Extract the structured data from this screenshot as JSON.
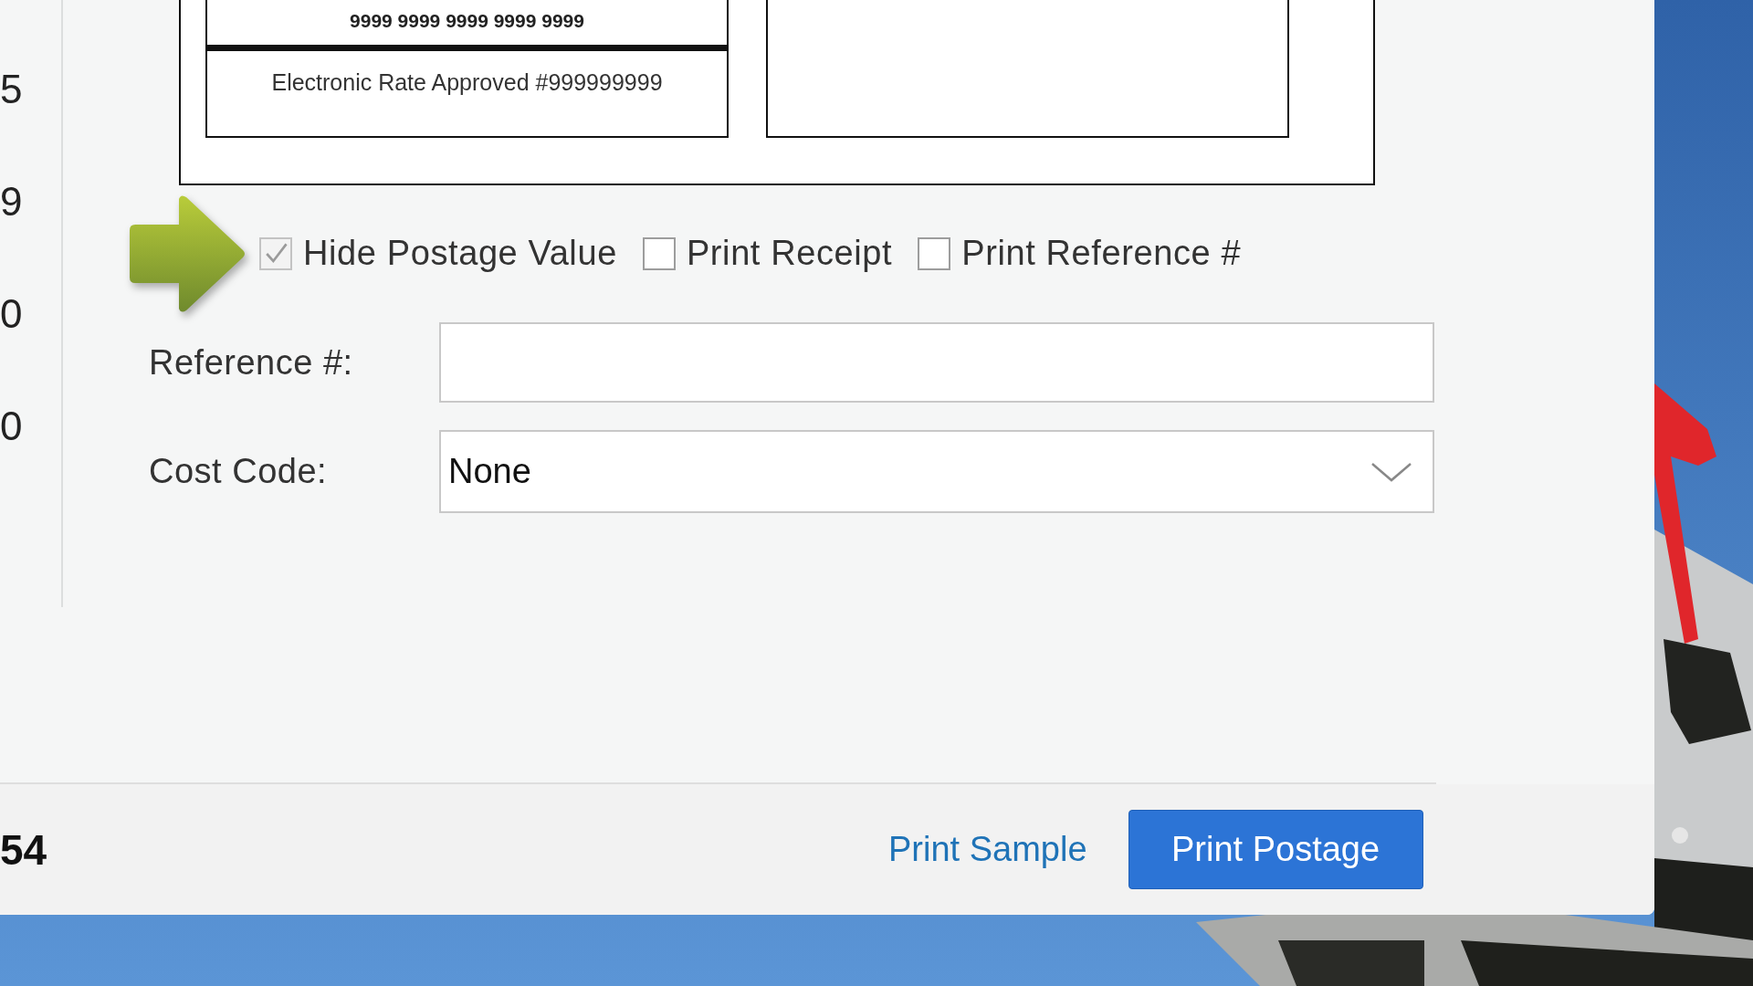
{
  "side_values": [
    "5",
    "9",
    "0",
    "0"
  ],
  "label_preview": {
    "tracking_number": "9999 9999 9999 9999 9999",
    "rate_text": "Electronic Rate Approved #999999999"
  },
  "options": [
    {
      "label": "Hide Postage Value",
      "checked": true,
      "disabled": true
    },
    {
      "label": "Print Receipt",
      "checked": false,
      "disabled": false
    },
    {
      "label": "Print Reference #",
      "checked": false,
      "disabled": false
    }
  ],
  "reference": {
    "label": "Reference #:"
  },
  "cost_code": {
    "label": "Cost Code:",
    "value": "None"
  },
  "footer": {
    "total": "54",
    "print_sample": "Print Sample",
    "print_postage": "Print Postage"
  }
}
